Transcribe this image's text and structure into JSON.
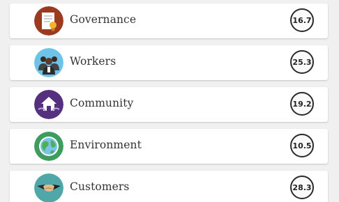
{
  "items": [
    {
      "label": "Governance",
      "score": "16.7",
      "icon": "certificate-icon",
      "color": "#9b3a1f"
    },
    {
      "label": "Workers",
      "score": "25.3",
      "icon": "workers-group-icon",
      "color": "#6ec3e8"
    },
    {
      "label": "Community",
      "score": "19.2",
      "icon": "community-house-icon",
      "color": "#55307f"
    },
    {
      "label": "Environment",
      "score": "10.5",
      "icon": "earth-globe-icon",
      "color": "#3e9c5f"
    },
    {
      "label": "Customers",
      "score": "28.3",
      "icon": "handshake-icon",
      "color": "#4fa7a8"
    }
  ]
}
